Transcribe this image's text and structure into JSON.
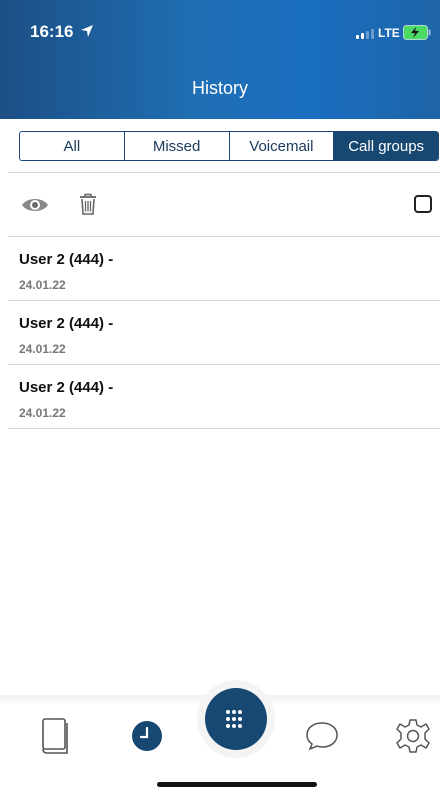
{
  "status_bar": {
    "time": "16:16",
    "network": "LTE"
  },
  "header": {
    "title": "History"
  },
  "tabs": [
    {
      "label": "All",
      "active": false
    },
    {
      "label": "Missed",
      "active": false
    },
    {
      "label": "Voicemail",
      "active": false
    },
    {
      "label": "Call groups",
      "active": true
    }
  ],
  "toolbar": {
    "mark_read_icon": "eye-icon",
    "delete_icon": "trash-icon",
    "select_all": "checkbox"
  },
  "history": [
    {
      "name": "User 2 (444) -",
      "date": "24.01.22"
    },
    {
      "name": "User 2 (444) -",
      "date": "24.01.22"
    },
    {
      "name": "User 2 (444) -",
      "date": "24.01.22"
    }
  ],
  "tabbar": {
    "items": [
      "contacts-book-icon",
      "history-clock-icon",
      "dialpad-icon",
      "chat-bubble-icon",
      "settings-gear-icon"
    ]
  },
  "colors": {
    "brand": "#164872",
    "header_start": "#1c4f85",
    "header_end": "#1e64a8",
    "secondary_text": "#777777"
  }
}
